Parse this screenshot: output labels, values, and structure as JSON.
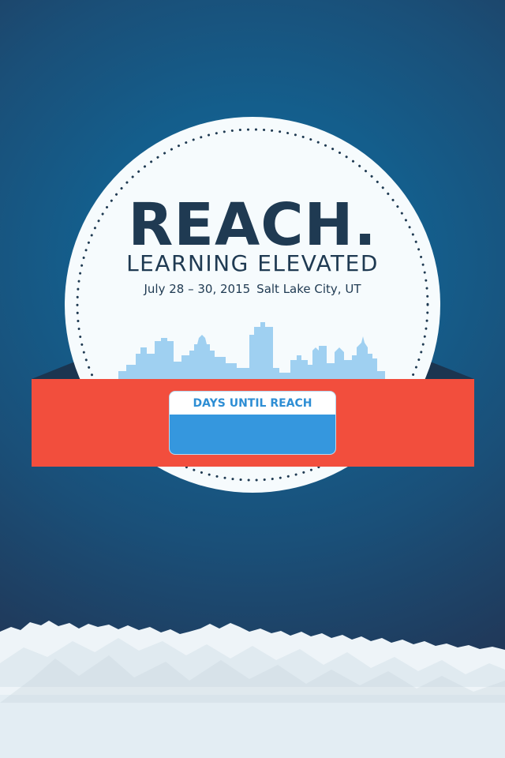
{
  "app": {
    "title": "REACH.",
    "tagline": "LEARNING ELEVATED",
    "dates": "July 28 – 30, 2015",
    "location": "Salt Lake City, UT"
  },
  "countdown": {
    "label": "DAYS UNTIL REACH",
    "value": ""
  },
  "colors": {
    "background": "#145e8c",
    "badge": "#f6fbfd",
    "title_text": "#1f3a52",
    "banner": "#f24e3d",
    "banner_fold": "#1b3550",
    "counter_label": "#2e8ed4",
    "counter_fill": "#3597de",
    "skyline": "#9fd0f1",
    "mountains": "#eef4f8"
  },
  "icons": {
    "skyline": "city-skyline-illustration",
    "mountains": "mountain-range-illustration"
  }
}
